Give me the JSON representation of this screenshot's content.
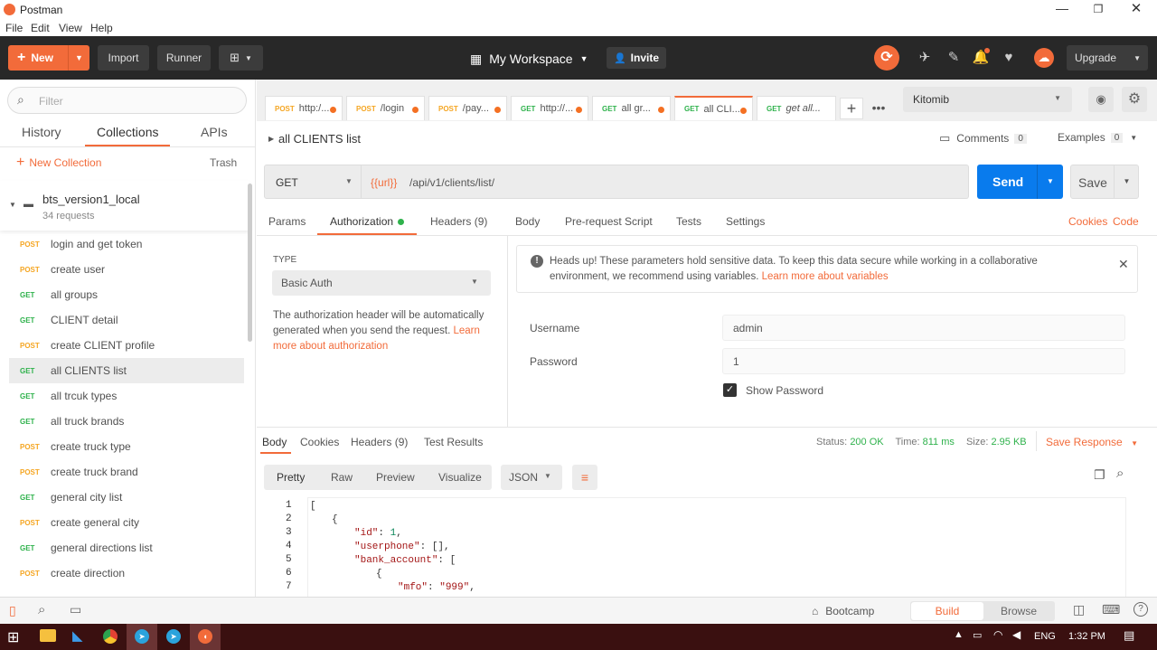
{
  "window": {
    "title": "Postman",
    "min_icon": "minimize-icon",
    "restore_icon": "restore-icon",
    "close_icon": "close-icon"
  },
  "menu": [
    "File",
    "Edit",
    "View",
    "Help"
  ],
  "toolbar": {
    "new_label": "New",
    "import_label": "Import",
    "runner_label": "Runner",
    "workspace_label": "My Workspace",
    "invite_label": "Invite",
    "upgrade_label": "Upgrade"
  },
  "sidebar": {
    "filter_placeholder": "Filter",
    "tabs": [
      "History",
      "Collections",
      "APIs"
    ],
    "new_collection": "New Collection",
    "trash": "Trash",
    "collection": {
      "name": "bts_version1_local",
      "count": "34 requests"
    },
    "items": [
      {
        "method": "POST",
        "name": "login and get token"
      },
      {
        "method": "POST",
        "name": "create user"
      },
      {
        "method": "GET",
        "name": "all groups"
      },
      {
        "method": "GET",
        "name": "CLIENT detail"
      },
      {
        "method": "POST",
        "name": "create CLIENT profile"
      },
      {
        "method": "GET",
        "name": "all CLIENTS list"
      },
      {
        "method": "GET",
        "name": "all trcuk types"
      },
      {
        "method": "GET",
        "name": "all truck brands"
      },
      {
        "method": "POST",
        "name": "create truck type"
      },
      {
        "method": "POST",
        "name": "create truck brand"
      },
      {
        "method": "GET",
        "name": "general city list"
      },
      {
        "method": "POST",
        "name": "create general city"
      },
      {
        "method": "GET",
        "name": "general directions list"
      },
      {
        "method": "POST",
        "name": "create direction"
      }
    ]
  },
  "req_tabs": [
    {
      "method": "POST",
      "label": "http:/..."
    },
    {
      "method": "POST",
      "label": "/login"
    },
    {
      "method": "POST",
      "label": "/pay..."
    },
    {
      "method": "GET",
      "label": "http://..."
    },
    {
      "method": "GET",
      "label": "all gr..."
    },
    {
      "method": "GET",
      "label": "all CLI..."
    },
    {
      "method": "GET",
      "label": "get all..."
    }
  ],
  "environment": "Kitomib",
  "request": {
    "name": "all CLIENTS list",
    "comments_label": "Comments",
    "comments_count": "0",
    "examples_label": "Examples",
    "examples_count": "0",
    "method": "GET",
    "url_var": "{{url}}",
    "url_path": "/api/v1/clients/list/",
    "send_label": "Send",
    "save_label": "Save",
    "subtabs": [
      "Params",
      "Authorization",
      "Headers (9)",
      "Body",
      "Pre-request Script",
      "Tests",
      "Settings"
    ],
    "cookies_link": "Cookies",
    "code_link": "Code"
  },
  "auth": {
    "type_label": "TYPE",
    "type_value": "Basic Auth",
    "desc": "The authorization header will be automatically generated when you send the request.",
    "desc_link": "Learn more about authorization",
    "alert_text": "Heads up! These parameters hold sensitive data. To keep this data secure while working in a collaborative environment, we recommend using variables.",
    "alert_link": "Learn more about variables",
    "username_label": "Username",
    "username_value": "admin",
    "password_label": "Password",
    "password_value": "1",
    "show_password_label": "Show Password"
  },
  "response": {
    "tabs": [
      "Body",
      "Cookies",
      "Headers (9)",
      "Test Results"
    ],
    "status_label": "Status:",
    "status_value": "200 OK",
    "time_label": "Time:",
    "time_value": "811 ms",
    "size_label": "Size:",
    "size_value": "2.95 KB",
    "save_response": "Save Response",
    "view_modes": [
      "Pretty",
      "Raw",
      "Preview",
      "Visualize"
    ],
    "format": "JSON"
  },
  "statusbar": {
    "bootcamp": "Bootcamp",
    "build": "Build",
    "browse": "Browse"
  },
  "taskbar": {
    "lang": "ENG",
    "time": "1:32 PM"
  },
  "colors": {
    "accent": "#f26b3a",
    "send_blue": "#097bed",
    "toolbar_bg": "#282828",
    "post": "#f5a623",
    "get": "#2fb24c"
  }
}
